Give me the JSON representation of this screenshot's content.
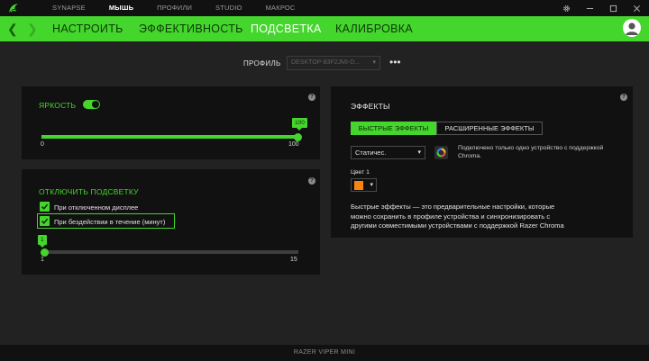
{
  "topnav": {
    "items": [
      "SYNAPSE",
      "МЫШЬ",
      "ПРОФИЛИ",
      "STUDIO",
      "МАКРОС"
    ],
    "active_index": 1
  },
  "window_controls": [
    "gear-icon",
    "minimize-icon",
    "maximize-icon",
    "close-icon"
  ],
  "subnav": {
    "tabs": [
      "НАСТРОИТЬ",
      "ЭФФЕКТИВНОСТЬ",
      "ПОДСВЕТКА",
      "КАЛИБРОВКА"
    ],
    "active_index": 2
  },
  "profile": {
    "label": "ПРОФИЛЬ",
    "value": "DESKTOP-83F2JMI-D...",
    "more": "•••"
  },
  "brightness": {
    "title": "ЯРКОСТЬ",
    "enabled": true,
    "value": 100,
    "min_label": "0",
    "max_label": "100",
    "bubble": "100"
  },
  "lighting_off": {
    "title": "ОТКЛЮЧИТЬ ПОДСВЕТКУ",
    "options": [
      {
        "label": "При отключенном дисплее",
        "checked": true
      },
      {
        "label": "При бездействии в течение (минут)",
        "checked": true
      }
    ],
    "minutes": 1,
    "min_label": "1",
    "max_label": "15",
    "bubble": "1"
  },
  "effects": {
    "title": "ЭФФЕКТЫ",
    "tabs": [
      "БЫСТРЫЕ ЭФФЕКТЫ",
      "РАСШИРЕННЫЕ ЭФФЕКТЫ"
    ],
    "active_tab": 0,
    "effect_value": "Статичес.",
    "chroma_note_line1": "Подключено только одно устройство с поддержкой",
    "chroma_note_line2": "Chroma.",
    "color_label": "Цвет 1",
    "color_value": "#f7840f",
    "desc_line1": "Быстрые эффекты — это предварительные настройки, которые",
    "desc_line2": "можно сохранить в профиле устройства и синхронизировать с",
    "desc_line3": "другими совместимыми устройствами с поддержкой Razer Chroma"
  },
  "footer": {
    "device": "RAZER VIPER MINI"
  },
  "colors": {
    "accent": "#44d62c",
    "background": "#222222",
    "panel": "#111111"
  }
}
